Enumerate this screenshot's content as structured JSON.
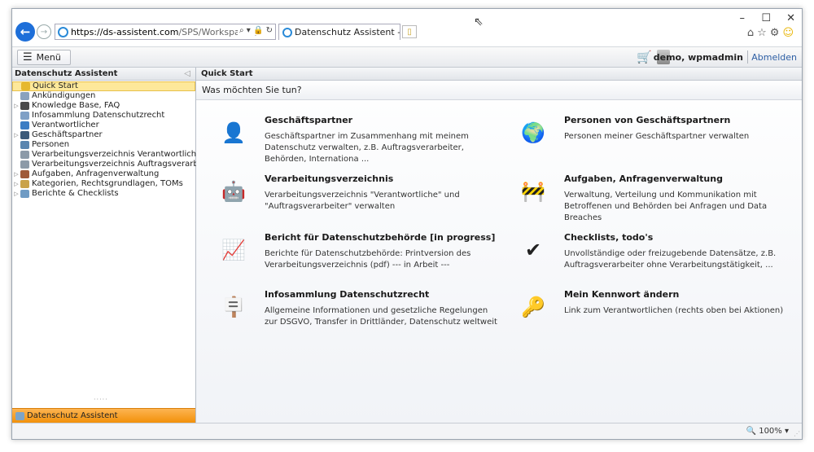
{
  "browser": {
    "url_host": "https://ds-assistent.com",
    "url_rest": "/SPS/Workspaces/Hc",
    "tab_title": "Datenschutz Assistent - igit ...",
    "zoom": "100%"
  },
  "toolbar": {
    "menu_label": "Menü",
    "user_label": "demo, wpmadmin",
    "logout_label": "Abmelden"
  },
  "left_panel": {
    "title": "Datenschutz Assistent",
    "bottom_tab": "Datenschutz Assistent",
    "items": [
      {
        "label": "Quick Start",
        "selected": true,
        "expandable": false,
        "icon": "star-icon",
        "color": "#e6b82e"
      },
      {
        "label": "Ankündigungen",
        "selected": false,
        "expandable": false,
        "icon": "megaphone-icon",
        "color": "#8aa2bd"
      },
      {
        "label": "Knowledge Base, FAQ",
        "selected": false,
        "expandable": true,
        "icon": "book-icon",
        "color": "#4a4a4a"
      },
      {
        "label": "Infosammlung Datenschutzrecht",
        "selected": false,
        "expandable": false,
        "icon": "document-icon",
        "color": "#7fa0c6"
      },
      {
        "label": "Verantwortlicher",
        "selected": false,
        "expandable": false,
        "icon": "org-icon",
        "color": "#3c7dc4"
      },
      {
        "label": "Geschäftspartner",
        "selected": false,
        "expandable": true,
        "icon": "person-icon",
        "color": "#3b5a7a"
      },
      {
        "label": "Personen",
        "selected": false,
        "expandable": false,
        "icon": "people-globe-icon",
        "color": "#5a86b0"
      },
      {
        "label": "Verarbeitungsverzeichnis Verantwortliche",
        "selected": false,
        "expandable": false,
        "icon": "register-icon",
        "color": "#8c9aa8"
      },
      {
        "label": "Verarbeitungsverzeichnis Auftragsverarbeiter",
        "selected": false,
        "expandable": false,
        "icon": "register-icon",
        "color": "#8c9aa8"
      },
      {
        "label": "Aufgaben, Anfragenverwaltung",
        "selected": false,
        "expandable": true,
        "icon": "tasks-icon",
        "color": "#a05a3a"
      },
      {
        "label": "Kategorien, Rechtsgrundlagen, TOMs",
        "selected": false,
        "expandable": true,
        "icon": "folder-icon",
        "color": "#c9a24a"
      },
      {
        "label": "Berichte & Checklists",
        "selected": false,
        "expandable": true,
        "icon": "report-icon",
        "color": "#6f9bc4"
      }
    ]
  },
  "main_panel": {
    "title": "Quick Start",
    "question": "Was möchten Sie tun?",
    "cards": [
      {
        "title": "Geschäftspartner",
        "desc": "Geschäftspartner im Zusammenhang mit meinem Datenschutz verwalten, z.B. Auftragsverarbeiter, Behörden, Internationa ...",
        "icon": "business-partner-icon",
        "glyph": "👤"
      },
      {
        "title": "Personen von Geschäftspartnern",
        "desc": "Personen meiner Geschäftspartner verwalten",
        "icon": "people-globe-icon",
        "glyph": "🌍"
      },
      {
        "title": "Verarbeitungsverzeichnis",
        "desc": "Verarbeitungsverzeichnis \"Verantwortliche\" und \"Auftragsverarbeiter\" verwalten",
        "icon": "robot-icon",
        "glyph": "🤖"
      },
      {
        "title": "Aufgaben, Anfragenverwaltung",
        "desc": "Verwaltung, Verteilung und Kommunikation mit Betroffenen und Behörden bei Anfragen und Data Breaches",
        "icon": "barrier-icon",
        "glyph": "🚧"
      },
      {
        "title": "Bericht für Datenschutzbehörde [in progress]",
        "desc": "Berichte für Datenschutzbehörde: Printversion des Verarbeitungsverzeichnis (pdf) --- in Arbeit ---",
        "icon": "presentation-board-icon",
        "glyph": "📈"
      },
      {
        "title": "Checklists, todo's",
        "desc": "Unvollständige oder freizugebende Datensätze, z.B. Auftragsverarbeiter ohne Verarbeitungstätigkeit, ...",
        "icon": "checkmark-icon",
        "glyph": "✔"
      },
      {
        "title": "Infosammlung Datenschutzrecht",
        "desc": "Allgemeine Informationen und gesetzliche Regelungen zur DSGVO, Transfer in Drittländer, Datenschutz weltweit",
        "icon": "signpost-icon",
        "glyph": "🪧"
      },
      {
        "title": "Mein Kennwort ändern",
        "desc": "Link zum Verantwortlichen (rechts oben bei Aktionen)",
        "icon": "keys-icon",
        "glyph": "🔑"
      }
    ]
  }
}
